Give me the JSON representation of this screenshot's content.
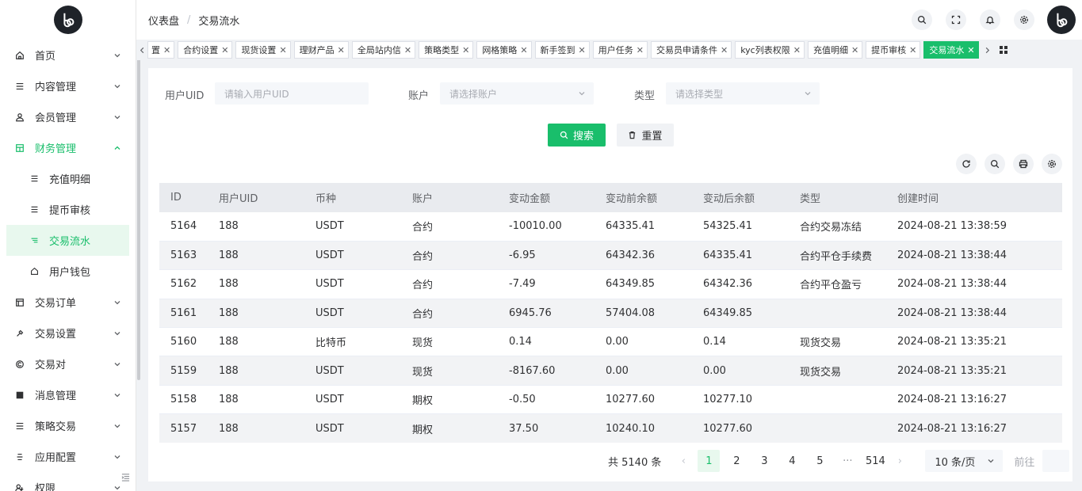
{
  "breadcrumb": {
    "root": "仪表盘",
    "current": "交易流水"
  },
  "colors": {
    "accent": "#19be6b",
    "accent_bg": "#e8f8ee"
  },
  "sidebar": {
    "items": [
      {
        "label": "首页",
        "icon": "home-icon"
      },
      {
        "label": "内容管理",
        "icon": "list-icon"
      },
      {
        "label": "会员管理",
        "icon": "user-icon"
      },
      {
        "label": "财务管理",
        "icon": "finance-icon"
      },
      {
        "label": "交易订单",
        "icon": "order-icon"
      },
      {
        "label": "交易设置",
        "icon": "settings-icon"
      },
      {
        "label": "交易对",
        "icon": "pair-icon"
      },
      {
        "label": "消息管理",
        "icon": "message-icon"
      },
      {
        "label": "策略交易",
        "icon": "strategy-icon"
      },
      {
        "label": "应用配置",
        "icon": "app-config-icon"
      },
      {
        "label": "权限",
        "icon": "permission-icon"
      }
    ],
    "finance_sub": [
      {
        "label": "充值明细"
      },
      {
        "label": "提币审核"
      },
      {
        "label": "交易流水"
      },
      {
        "label": "用户钱包"
      }
    ]
  },
  "tabs": [
    "置",
    "合约设置",
    "现货设置",
    "理财产品",
    "全局站内信",
    "策略类型",
    "网格策略",
    "新手签到",
    "用户任务",
    "交易员申请条件",
    "kyc列表权限",
    "充值明细",
    "提币审核",
    "交易流水"
  ],
  "filters": {
    "uid_label": "用户UID",
    "uid_placeholder": "请输入用户UID",
    "account_label": "账户",
    "account_placeholder": "请选择账户",
    "type_label": "类型",
    "type_placeholder": "请选择类型"
  },
  "buttons": {
    "search": "搜索",
    "reset": "重置"
  },
  "table": {
    "headers": [
      "ID",
      "用户UID",
      "币种",
      "账户",
      "变动金额",
      "变动前余额",
      "变动后余额",
      "类型",
      "创建时间"
    ],
    "rows": [
      [
        "5164",
        "188",
        "USDT",
        "合约",
        "-10010.00",
        "64335.41",
        "54325.41",
        "合约交易冻结",
        "2024-08-21 13:38:59"
      ],
      [
        "5163",
        "188",
        "USDT",
        "合约",
        "-6.95",
        "64342.36",
        "64335.41",
        "合约平仓手续费",
        "2024-08-21 13:38:44"
      ],
      [
        "5162",
        "188",
        "USDT",
        "合约",
        "-7.49",
        "64349.85",
        "64342.36",
        "合约平仓盈亏",
        "2024-08-21 13:38:44"
      ],
      [
        "5161",
        "188",
        "USDT",
        "合约",
        "6945.76",
        "57404.08",
        "64349.85",
        "",
        "2024-08-21 13:38:44"
      ],
      [
        "5160",
        "188",
        "比特币",
        "现货",
        "0.14",
        "0.00",
        "0.14",
        "现货交易",
        "2024-08-21 13:35:21"
      ],
      [
        "5159",
        "188",
        "USDT",
        "现货",
        "-8167.60",
        "0.00",
        "0.00",
        "现货交易",
        "2024-08-21 13:35:21"
      ],
      [
        "5158",
        "188",
        "USDT",
        "期权",
        "-0.50",
        "10277.60",
        "10277.10",
        "",
        "2024-08-21 13:16:27"
      ],
      [
        "5157",
        "188",
        "USDT",
        "期权",
        "37.50",
        "10240.10",
        "10277.60",
        "",
        "2024-08-21 13:16:27"
      ]
    ]
  },
  "pagination": {
    "total_text": "共 5140 条",
    "pages": [
      "1",
      "2",
      "3",
      "4",
      "5",
      "···",
      "514"
    ],
    "current": "1",
    "page_size": "10 条/页",
    "goto_label": "前往"
  }
}
